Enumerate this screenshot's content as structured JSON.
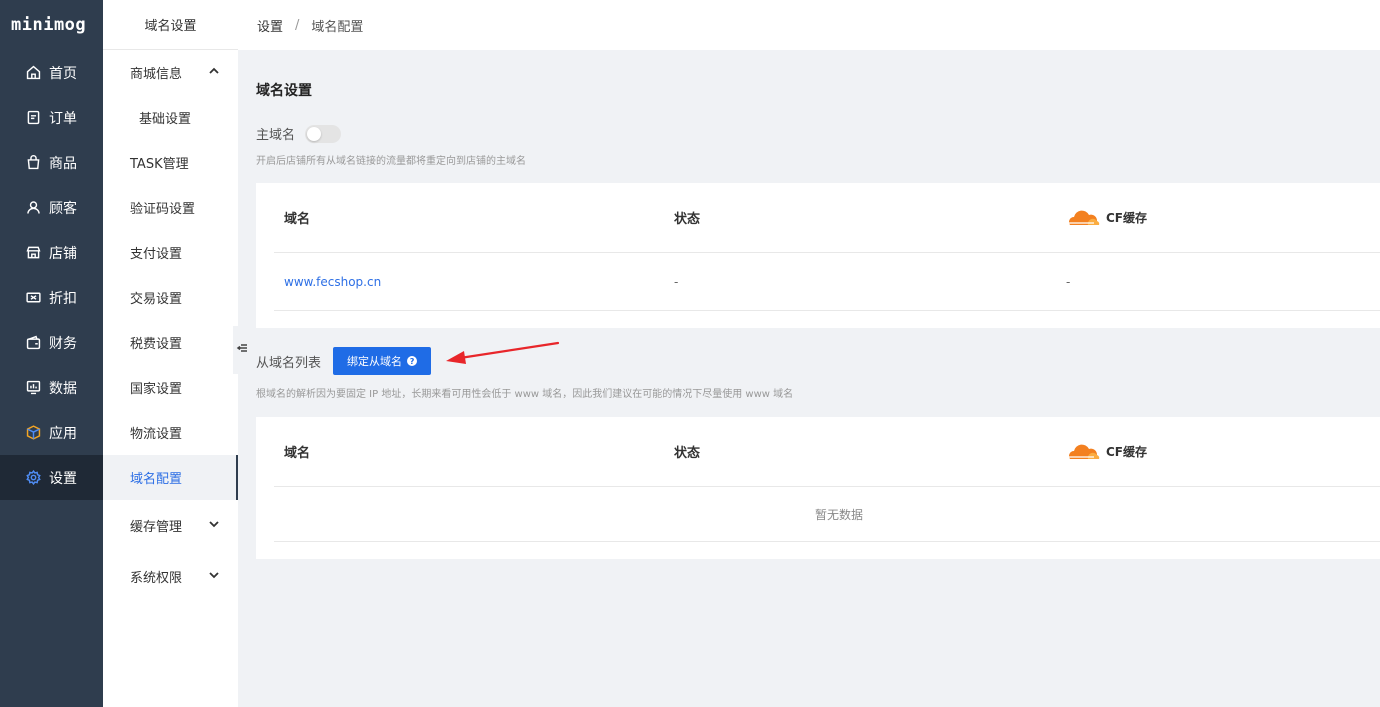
{
  "app": {
    "logo": "minimog"
  },
  "nav": {
    "items": [
      {
        "label": "首页",
        "icon": "home-icon"
      },
      {
        "label": "订单",
        "icon": "order-icon"
      },
      {
        "label": "商品",
        "icon": "bag-icon"
      },
      {
        "label": "顾客",
        "icon": "user-icon"
      },
      {
        "label": "店铺",
        "icon": "store-icon"
      },
      {
        "label": "折扣",
        "icon": "ticket-icon"
      },
      {
        "label": "财务",
        "icon": "wallet-icon"
      },
      {
        "label": "数据",
        "icon": "chart-icon"
      },
      {
        "label": "应用",
        "icon": "box-icon"
      },
      {
        "label": "设置",
        "icon": "gear-icon",
        "active": true
      }
    ]
  },
  "subnav": {
    "title": "域名设置",
    "items": [
      {
        "label": "商城信息",
        "expanded": true
      },
      {
        "label": "基础设置"
      },
      {
        "label": "TASK管理"
      },
      {
        "label": "验证码设置"
      },
      {
        "label": "支付设置"
      },
      {
        "label": "交易设置"
      },
      {
        "label": "税费设置"
      },
      {
        "label": "国家设置"
      },
      {
        "label": "物流设置"
      },
      {
        "label": "域名配置",
        "active": true
      },
      {
        "label": "缓存管理",
        "expanded": false
      },
      {
        "label": "系统权限",
        "expanded": false
      }
    ]
  },
  "breadcrumb": {
    "root": "设置",
    "separator": "/",
    "current": "域名配置"
  },
  "main": {
    "section_title": "域名设置",
    "main_domain_label": "主域名",
    "main_domain_enabled": false,
    "main_domain_hint": "开启后店铺所有从域名链接的流量都将重定向到店铺的主域名",
    "table1": {
      "columns": [
        "域名",
        "状态",
        "CF缓存"
      ],
      "rows": [
        {
          "domain": "www.fecshop.cn",
          "status": "-",
          "cf": "-"
        }
      ]
    },
    "sub_list_label": "从域名列表",
    "bind_button": "绑定从域名",
    "sub_hint": "根域名的解析因为要固定 IP 地址，长期来看可用性会低于 www 域名，因此我们建议在可能的情况下尽量使用 www 域名",
    "table2": {
      "columns": [
        "域名",
        "状态",
        "CF缓存"
      ],
      "empty_text": "暂无数据"
    }
  },
  "colors": {
    "nav_bg": "#2f3d4e",
    "accent": "#1f6ce6",
    "cloudflare": "#f38020",
    "arrow": "#e8262a"
  }
}
